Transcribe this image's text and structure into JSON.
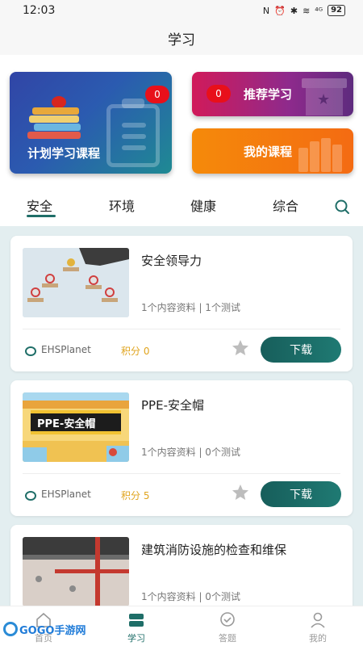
{
  "status_bar": {
    "time": "12:03",
    "signal": "⁴ᴳ",
    "battery": "92"
  },
  "header": {
    "title": "学习"
  },
  "top_cards": {
    "plan": {
      "label": "计划学习课程",
      "badge": "0"
    },
    "recommend": {
      "label": "推荐学习",
      "badge": "0"
    },
    "mine": {
      "label": "我的课程"
    }
  },
  "tabs": [
    {
      "label": "安全",
      "active": true
    },
    {
      "label": "环境"
    },
    {
      "label": "健康"
    },
    {
      "label": "综合"
    }
  ],
  "courses": [
    {
      "title": "安全领导力",
      "meta": "1个内容资料 | 1个测试",
      "org": "EHSPlanet",
      "points": "积分 0",
      "download": "下载"
    },
    {
      "title": "PPE-安全帽",
      "thumb_text": "PPE-安全帽",
      "meta": "1个内容资料 | 0个测试",
      "org": "EHSPlanet",
      "points": "积分 5",
      "download": "下载"
    },
    {
      "title": "建筑消防设施的检查和维保",
      "meta": "1个内容资料 | 0个测试"
    }
  ],
  "bottom_nav": [
    {
      "label": "首页",
      "icon": "home-icon"
    },
    {
      "label": "学习",
      "icon": "learn-icon",
      "active": true
    },
    {
      "label": "答题",
      "icon": "quiz-icon"
    },
    {
      "label": "我的",
      "icon": "profile-icon"
    }
  ],
  "watermark": {
    "text": "GOGO手游网"
  },
  "colors": {
    "accent": "#1f6e68",
    "badge": "#e8101a",
    "points": "#e0a41e"
  }
}
